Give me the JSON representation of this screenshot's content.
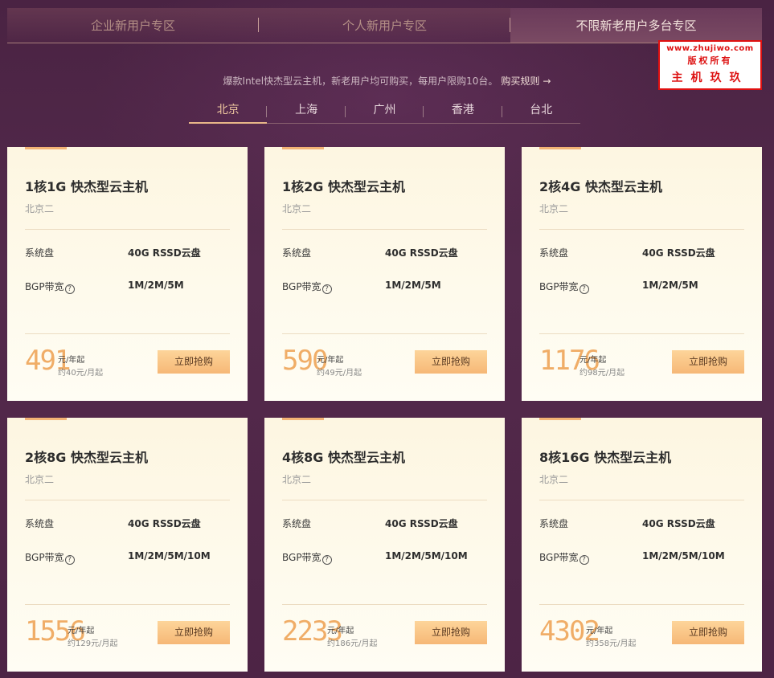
{
  "zone_tabs": [
    {
      "label": "企业新用户专区",
      "active": false
    },
    {
      "label": "个人新用户专区",
      "active": false
    },
    {
      "label": "不限新老用户多台专区",
      "active": true
    }
  ],
  "watermark": {
    "line1": "www.zhujiwo.com",
    "line2": "版权所有",
    "line3": "主机玖玖"
  },
  "promo": {
    "text": "爆款Intel快杰型云主机，新老用户均可购买，每用户限购10台。",
    "rule_link": "购买规则",
    "arrow": "→"
  },
  "region_tabs": [
    {
      "label": "北京",
      "active": true
    },
    {
      "label": "上海",
      "active": false
    },
    {
      "label": "广州",
      "active": false
    },
    {
      "label": "香港",
      "active": false
    },
    {
      "label": "台北",
      "active": false
    }
  ],
  "cards": [
    {
      "title": "1核1G 快杰型云主机",
      "location": "北京二",
      "disk_label": "系统盘",
      "disk_value": "40G RSSD云盘",
      "bw_label": "BGP带宽",
      "bw_help": "?",
      "bw_value": "1M/2M/5M",
      "price": "491",
      "unit": "元/年起",
      "monthly": "约40元/月起",
      "button": "立即抢购"
    },
    {
      "title": "1核2G 快杰型云主机",
      "location": "北京二",
      "disk_label": "系统盘",
      "disk_value": "40G RSSD云盘",
      "bw_label": "BGP带宽",
      "bw_help": "?",
      "bw_value": "1M/2M/5M",
      "price": "590",
      "unit": "元/年起",
      "monthly": "约49元/月起",
      "button": "立即抢购"
    },
    {
      "title": "2核4G 快杰型云主机",
      "location": "北京二",
      "disk_label": "系统盘",
      "disk_value": "40G RSSD云盘",
      "bw_label": "BGP带宽",
      "bw_help": "?",
      "bw_value": "1M/2M/5M",
      "price": "1176",
      "unit": "元/年起",
      "monthly": "约98元/月起",
      "button": "立即抢购"
    },
    {
      "title": "2核8G 快杰型云主机",
      "location": "北京二",
      "disk_label": "系统盘",
      "disk_value": "40G RSSD云盘",
      "bw_label": "BGP带宽",
      "bw_help": "?",
      "bw_value": "1M/2M/5M/10M",
      "price": "1556",
      "unit": "元/年起",
      "monthly": "约129元/月起",
      "button": "立即抢购"
    },
    {
      "title": "4核8G 快杰型云主机",
      "location": "北京二",
      "disk_label": "系统盘",
      "disk_value": "40G RSSD云盘",
      "bw_label": "BGP带宽",
      "bw_help": "?",
      "bw_value": "1M/2M/5M/10M",
      "price": "2233",
      "unit": "元/年起",
      "monthly": "约186元/月起",
      "button": "立即抢购"
    },
    {
      "title": "8核16G 快杰型云主机",
      "location": "北京二",
      "disk_label": "系统盘",
      "disk_value": "40G RSSD云盘",
      "bw_label": "BGP带宽",
      "bw_help": "?",
      "bw_value": "1M/2M/5M/10M",
      "price": "4302",
      "unit": "元/年起",
      "monthly": "约358元/月起",
      "button": "立即抢购"
    }
  ]
}
